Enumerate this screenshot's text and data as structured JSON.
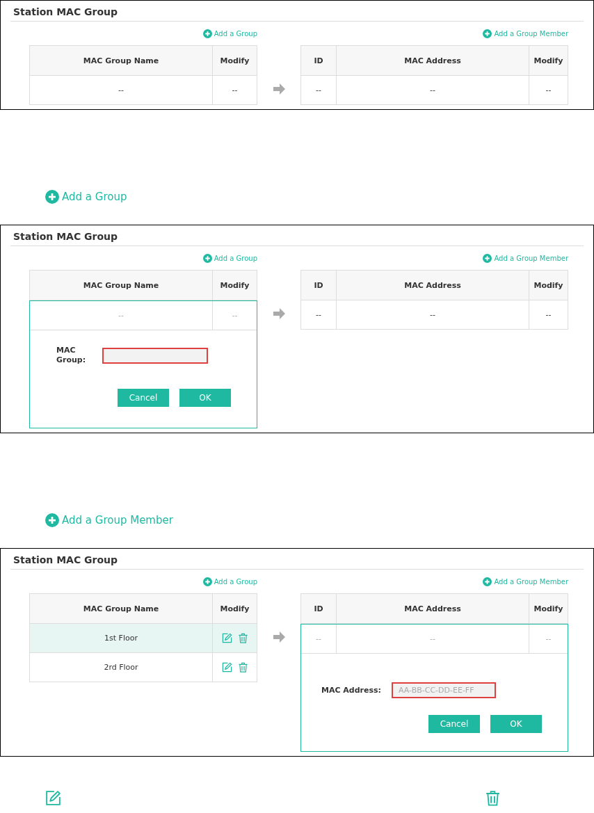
{
  "sections": [
    {
      "kind": "panel",
      "title": "Station MAC Group",
      "add_group": "Add a Group",
      "add_member": "Add a Group Member",
      "groups": {
        "columns": [
          "MAC Group Name",
          "Modify"
        ],
        "rows": [
          {
            "cells": [
              "--"
            ],
            "modify": {
              "kind": "text",
              "text": "--"
            },
            "selected": false,
            "muted": false
          }
        ]
      },
      "members": {
        "columns": [
          "ID",
          "MAC Address",
          "Modify"
        ],
        "rows": [
          {
            "cells": [
              "--",
              "--"
            ],
            "modify": {
              "kind": "text",
              "text": "--"
            },
            "selected": false,
            "muted": false
          }
        ]
      }
    },
    {
      "kind": "callout",
      "text": "Add a Group"
    },
    {
      "kind": "panel",
      "title": "Station MAC Group",
      "add_group": "Add a Group",
      "add_member": "Add a Group Member",
      "groups": {
        "columns": [
          "MAC Group Name",
          "Modify"
        ],
        "rows": [
          {
            "cells": [
              "--"
            ],
            "modify": {
              "kind": "text",
              "text": "--"
            },
            "selected": false,
            "muted": true
          }
        ],
        "form": {
          "label": "MAC Group:",
          "cancel": "Cancel",
          "ok": "OK"
        }
      },
      "members": {
        "columns": [
          "ID",
          "MAC Address",
          "Modify"
        ],
        "rows": [
          {
            "cells": [
              "--",
              "--"
            ],
            "modify": {
              "kind": "text",
              "text": "--"
            },
            "selected": false,
            "muted": false
          }
        ]
      }
    },
    {
      "kind": "callout",
      "text": "Add a Group Member"
    },
    {
      "kind": "panel",
      "title": "Station MAC Group",
      "add_group": "Add a Group",
      "add_member": "Add a Group Member",
      "groups": {
        "columns": [
          "MAC Group Name",
          "Modify"
        ],
        "rows": [
          {
            "cells": [
              "1st Floor"
            ],
            "modify": {
              "kind": "icons"
            },
            "selected": true,
            "muted": false
          },
          {
            "cells": [
              "2rd Floor"
            ],
            "modify": {
              "kind": "icons"
            },
            "selected": false,
            "muted": false
          }
        ]
      },
      "members": {
        "columns": [
          "ID",
          "MAC Address",
          "Modify"
        ],
        "rows": [
          {
            "cells": [
              "--",
              "--"
            ],
            "modify": {
              "kind": "text",
              "text": "--"
            },
            "selected": false,
            "muted": true
          }
        ],
        "form": {
          "label": "MAC Address:",
          "placeholder": "AA-BB-CC-DD-EE-FF",
          "cancel": "Cancel",
          "ok": "OK"
        }
      }
    },
    {
      "kind": "icons",
      "icons": [
        {
          "kind": "edit"
        },
        {
          "kind": "trash"
        }
      ]
    }
  ]
}
